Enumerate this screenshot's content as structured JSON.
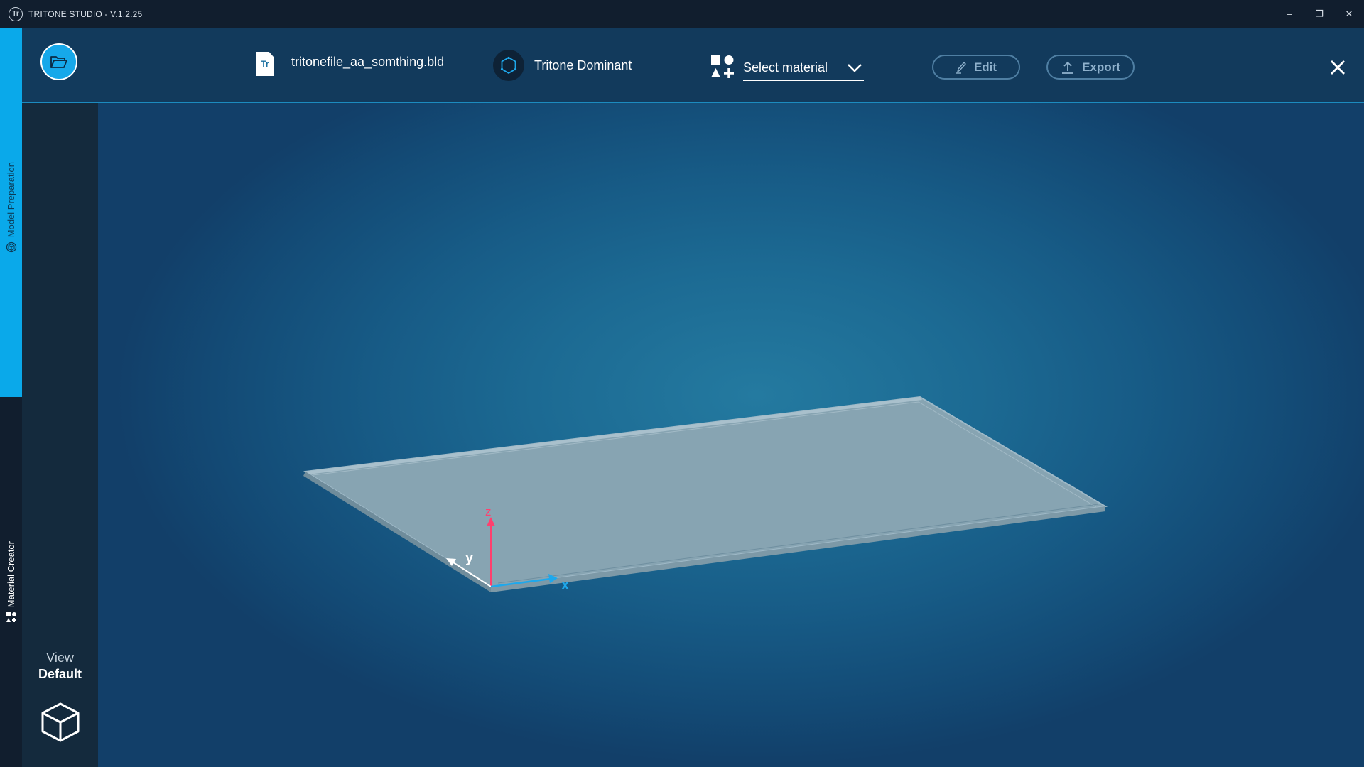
{
  "window": {
    "title": "TRITONE STUDIO - V.1.2.25",
    "logo_glyph": "Tr",
    "controls": {
      "minimize": "–",
      "maximize": "❐",
      "close": "✕"
    }
  },
  "rail": {
    "model_preparation": "Model Preparation",
    "material_creator": "Material Creator",
    "active_color": "#0aa9ea"
  },
  "header": {
    "file_icon_glyph": "Tr",
    "file_name": "tritonefile_aa_somthing.bld",
    "printer_name": "Tritone Dominant",
    "material_select": {
      "label": "Select material"
    },
    "edit_label": "Edit",
    "export_label": "Export"
  },
  "viewport": {
    "axes": {
      "x": "x",
      "y": "y",
      "z": "z"
    },
    "axis_colors": {
      "x": "#1ea8ec",
      "y": "#ffffff",
      "z": "#ff3f6e"
    }
  },
  "view": {
    "label": "View",
    "value": "Default"
  }
}
